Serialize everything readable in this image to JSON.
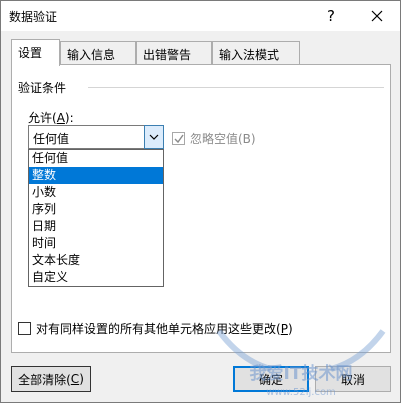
{
  "window": {
    "title": "数据验证",
    "help_glyph": "?",
    "close_icon": "close-icon"
  },
  "tabs": [
    {
      "label": "设置",
      "active": true
    },
    {
      "label": "输入信息",
      "active": false
    },
    {
      "label": "出错警告",
      "active": false
    },
    {
      "label": "输入法模式",
      "active": false
    }
  ],
  "settings": {
    "group_title": "验证条件",
    "allow_label_prefix": "允许(",
    "allow_label_key": "A",
    "allow_label_suffix": "):",
    "allow_value": "任何值",
    "ignore_blank_label": "忽略空值(B)",
    "ignore_blank_checked": true,
    "ignore_blank_enabled": false,
    "options": [
      "任何值",
      "整数",
      "小数",
      "序列",
      "日期",
      "时间",
      "文本长度",
      "自定义"
    ],
    "highlighted_option": "整数",
    "apply_all_prefix": "对有同样设置的所有其他单元格应用这些更改(",
    "apply_all_key": "P",
    "apply_all_suffix": ")",
    "apply_all_checked": false
  },
  "buttons": {
    "clear_prefix": "全部清除(",
    "clear_key": "C",
    "clear_suffix": ")",
    "ok": "确定",
    "cancel": "取消"
  },
  "watermark": {
    "line1": "我爱IT技术网",
    "line2": "www.52ij.com"
  },
  "colors": {
    "selection": "#0078d7",
    "dialog_bg": "#f0f0f0",
    "ok_border": "#0078d7"
  }
}
